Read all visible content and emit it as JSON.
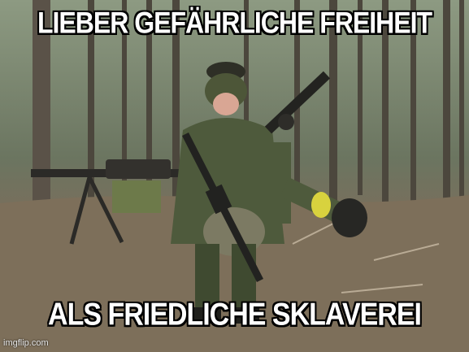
{
  "meme": {
    "top_text": "LIEBER GEFÄHRLICHE FREIHEIT",
    "bottom_text": "ALS FRIEDLICHE SKLAVEREI",
    "watermark": "imgflip.com"
  },
  "colors": {
    "caption_fill": "#ffffff",
    "caption_outline": "#000000",
    "forest_ground": "#7d6f5a",
    "uniform": "#4e5a3c"
  }
}
